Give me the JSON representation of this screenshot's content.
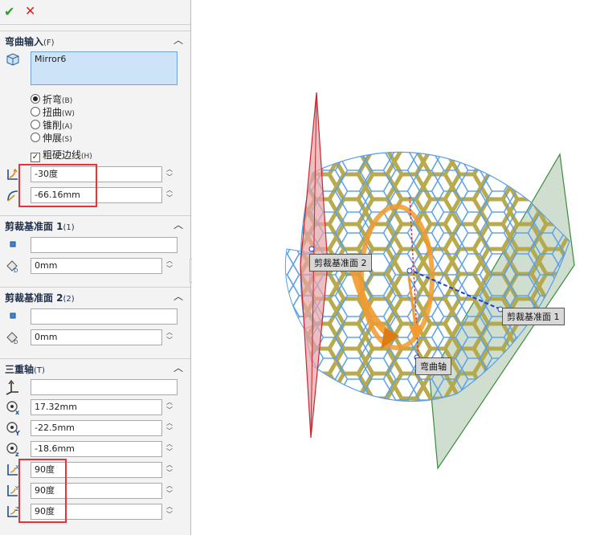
{
  "toolbar": {
    "ok_icon": "✔",
    "cancel_icon": "✕"
  },
  "flex_input": {
    "title": "弯曲输入",
    "accel": "(F)",
    "body_name": "Mirror6",
    "options": [
      {
        "label": "折弯",
        "accel": "(B)",
        "selected": true
      },
      {
        "label": "扭曲",
        "accel": "(W)",
        "selected": false
      },
      {
        "label": "锥削",
        "accel": "(A)",
        "selected": false
      },
      {
        "label": "伸展",
        "accel": "(S)",
        "selected": false
      }
    ],
    "hard_edges_label": "粗硬边线",
    "hard_edges_accel": "(H)",
    "angle": "-30度",
    "radius": "-66.16mm"
  },
  "trim_plane_1": {
    "title": "剪裁基准面 1",
    "accel": "(1)",
    "reference": "",
    "distance": "0mm"
  },
  "trim_plane_2": {
    "title": "剪裁基准面 2",
    "accel": "(2)",
    "reference": "",
    "distance": "0mm"
  },
  "triad": {
    "title": "三重轴",
    "accel": "(T)",
    "reference": "",
    "x": "17.32mm",
    "y": "-22.5mm",
    "z": "-18.6mm",
    "rot_x": "90度",
    "rot_y": "90度",
    "rot_z": "90度"
  },
  "viewport": {
    "callout_trim_2": "剪裁基准面 2",
    "callout_trim_1": "剪裁基准面 1",
    "callout_axis": "弯曲轴"
  },
  "colors": {
    "highlight_box": "#e5323b",
    "plane_red": "#e0555a",
    "plane_green": "#3c8a3c",
    "mesh_gold": "#b3a646",
    "mesh_blue": "#5aa0e6",
    "axis_orange": "#f29a2e"
  }
}
